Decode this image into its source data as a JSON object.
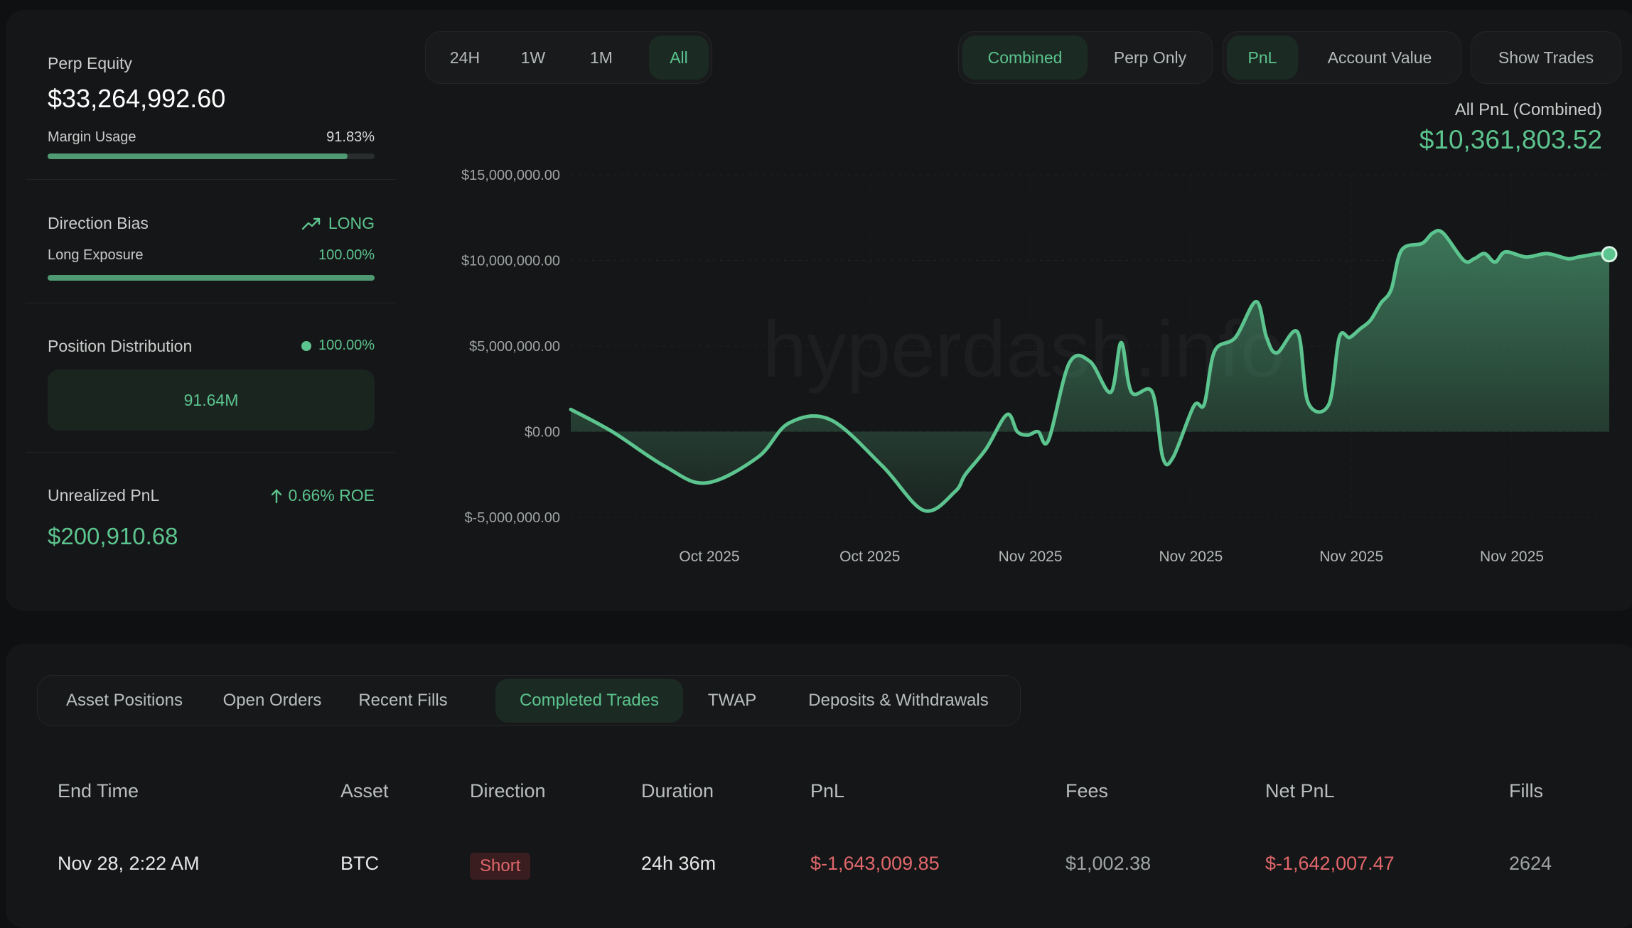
{
  "summary": {
    "perp_equity_label": "Perp Equity",
    "perp_equity_value": "$33,264,992.60",
    "margin_usage_label": "Margin Usage",
    "margin_usage_value": "91.83%",
    "margin_usage_fraction": 0.9183,
    "direction_bias_label": "Direction Bias",
    "direction_bias_value": "LONG",
    "long_exposure_label": "Long Exposure",
    "long_exposure_value": "100.00%",
    "long_exposure_fraction": 1.0,
    "position_distribution_label": "Position Distribution",
    "position_distribution_value": "100.00%",
    "position_distribution_amount": "91.64M",
    "unrealized_pnl_label": "Unrealized PnL",
    "unrealized_roe": "0.66% ROE",
    "unrealized_pnl_value": "$200,910.68"
  },
  "timeframes": [
    "24H",
    "1W",
    "1M",
    "All"
  ],
  "timeframe_selected": "All",
  "view_modes": [
    "Combined",
    "Perp Only"
  ],
  "view_mode_selected": "Combined",
  "metrics": [
    "PnL",
    "Account Value"
  ],
  "metric_selected": "PnL",
  "show_trades_label": "Show Trades",
  "pnl_header": {
    "label": "All PnL (Combined)",
    "value": "$10,361,803.52"
  },
  "watermark": "hyperdash.info",
  "chart_data": {
    "type": "area",
    "ylim": [
      -5000000,
      15000000
    ],
    "yticks": [
      15000000,
      10000000,
      5000000,
      0,
      -5000000
    ],
    "ytick_labels": [
      "$15,000,000.00",
      "$10,000,000.00",
      "$5,000,000.00",
      "$0.00",
      "$-5,000,000.00"
    ],
    "xtick_labels": [
      "Oct 2025",
      "Oct 2025",
      "Nov 2025",
      "Nov 2025",
      "Nov 2025",
      "Nov 2025"
    ],
    "x": [
      0,
      4,
      9,
      13,
      18,
      21,
      25,
      30,
      34,
      37,
      38,
      40,
      42,
      43,
      44,
      45,
      46,
      48,
      50,
      52,
      53,
      54,
      56,
      57,
      58,
      60,
      61,
      62,
      64,
      66,
      67,
      68,
      70,
      71,
      73,
      74,
      75,
      76,
      77,
      78,
      79,
      80,
      82,
      83,
      84,
      86,
      87,
      88,
      89,
      90,
      92,
      94,
      96,
      97,
      98,
      99,
      100
    ],
    "values": [
      1300000,
      0,
      -2000000,
      -3000000,
      -1500000,
      500000,
      700000,
      -2000000,
      -4600000,
      -3500000,
      -2500000,
      -1000000,
      1000000,
      0,
      -200000,
      0,
      -500000,
      4000000,
      4100000,
      2300000,
      5200000,
      2300000,
      2300000,
      -1500000,
      -1500000,
      1500000,
      1600000,
      4700000,
      5500000,
      7600000,
      5500000,
      4600000,
      5800000,
      1700000,
      1600000,
      5500000,
      5500000,
      6000000,
      6500000,
      7500000,
      8300000,
      10600000,
      11000000,
      11600000,
      11600000,
      10000000,
      10100000,
      10400000,
      9900000,
      10500000,
      10200000,
      10400000,
      10100000,
      10200000,
      10300000,
      10400000,
      10361803.52
    ],
    "series_color": "#5cc48e",
    "grid": true
  },
  "tabs": [
    "Asset Positions",
    "Open Orders",
    "Recent Fills",
    "Completed Trades",
    "TWAP",
    "Deposits & Withdrawals"
  ],
  "tab_selected": "Completed Trades",
  "table": {
    "columns": [
      "End Time",
      "Asset",
      "Direction",
      "Duration",
      "PnL",
      "Fees",
      "Net PnL",
      "Fills"
    ],
    "rows": [
      [
        "Nov 28, 2:22 AM",
        "BTC",
        "Short",
        "24h 36m",
        "$-1,643,009.85",
        "$1,002.38",
        "$-1,642,007.47",
        "2624"
      ]
    ]
  }
}
